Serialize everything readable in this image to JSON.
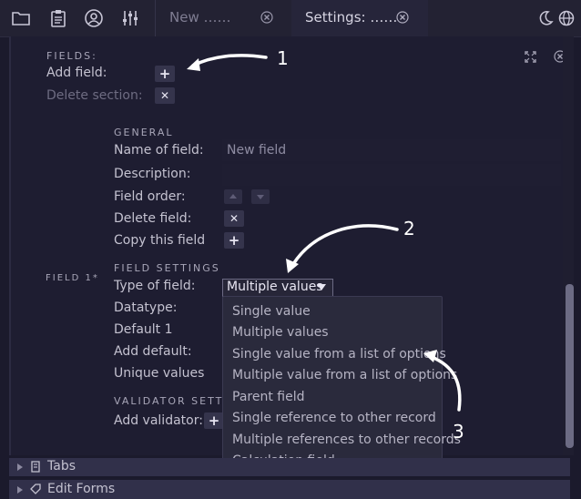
{
  "toolbar": {
    "icons": [
      "folder-icon",
      "clipboard-icon",
      "user-circle-icon",
      "sliders-icon"
    ],
    "right_icons": [
      "moon-icon",
      "globe-icon"
    ]
  },
  "tabs": [
    {
      "label": "New ……"
    },
    {
      "label": "Settings: ……"
    }
  ],
  "fields_section": {
    "heading": "FIELDS:",
    "add_field_label": "Add field:",
    "add_button": "+",
    "delete_section_label": "Delete section:",
    "delete_button": "✕"
  },
  "field": {
    "title": "FIELD 1*",
    "general_heading": "GENERAL",
    "name_label": "Name of field:",
    "name_value": "New field",
    "description_label": "Description:",
    "order_label": "Field order:",
    "delete_label": "Delete field:",
    "delete_button": "✕",
    "copy_label": "Copy this field",
    "copy_button": "+",
    "settings_heading": "FIELD SETTINGS",
    "type_label": "Type of field:",
    "type_value": "Multiple values",
    "datatype_label": "Datatype:",
    "default_label": "Default 1",
    "add_default_label": "Add default:",
    "unique_label": "Unique values",
    "validator_heading": "VALIDATOR SETTIN",
    "add_validator_label": "Add validator:",
    "add_validator_button": "+"
  },
  "dropdown_options": [
    "Single value",
    "Multiple values",
    "Single value from a list of options",
    "Multiple value from a list of options",
    "Parent field",
    "Single reference to other record",
    "Multiple references to other records",
    "Calculation field"
  ],
  "sections": [
    {
      "label": "Tabs"
    },
    {
      "label": "Edit Forms"
    }
  ],
  "callouts": [
    "1",
    "2",
    "3"
  ]
}
